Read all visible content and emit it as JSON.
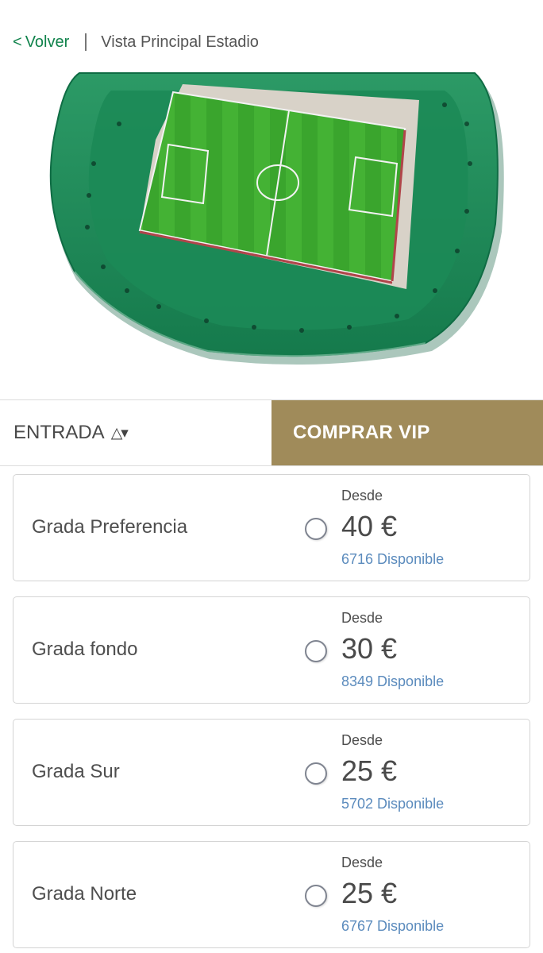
{
  "header": {
    "back_label": "Volver",
    "back_chevron": "<",
    "breadcrumb": "Vista Principal Estadio"
  },
  "stadium": {
    "pitch_color": "#3fae32",
    "stand_color": "#1f8f5b"
  },
  "tabs": {
    "entrada_label": "ENTRADA",
    "sort_icon": "△▾",
    "vip_label": "COMPRAR VIP",
    "vip_color": "#a08b5a"
  },
  "sections": [
    {
      "name": "Grada Preferencia",
      "from_label": "Desde",
      "price": "40 €",
      "available": "6716 Disponible"
    },
    {
      "name": "Grada fondo",
      "from_label": "Desde",
      "price": "30 €",
      "available": "8349 Disponible"
    },
    {
      "name": "Grada Sur",
      "from_label": "Desde",
      "price": "25 €",
      "available": "5702 Disponible"
    },
    {
      "name": "Grada Norte",
      "from_label": "Desde",
      "price": "25 €",
      "available": "6767 Disponible"
    }
  ],
  "colors": {
    "accent_green": "#11834c",
    "availability_blue": "#5b8bbd"
  }
}
